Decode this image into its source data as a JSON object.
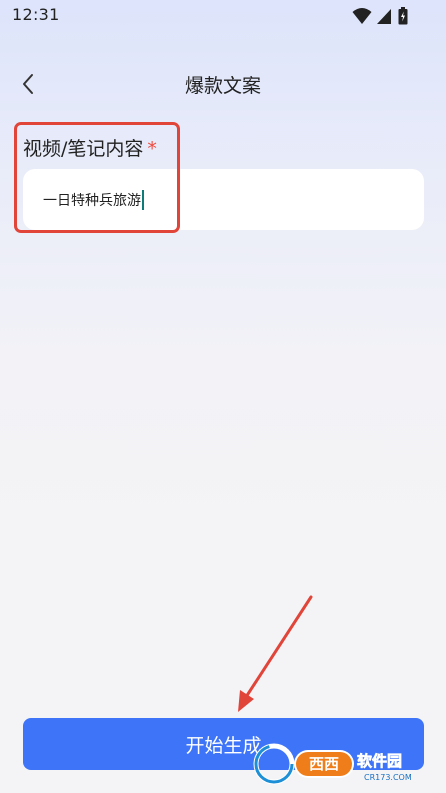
{
  "status_bar": {
    "time": "12:31",
    "icons": [
      "wifi-icon",
      "signal-icon",
      "battery-icon"
    ]
  },
  "header": {
    "back_icon": "chevron-left-icon",
    "title": "爆款文案"
  },
  "form": {
    "content_label": "视频/笔记内容",
    "required_mark": "*",
    "content_value": "一日特种兵旅游"
  },
  "actions": {
    "start_label": "开始生成"
  },
  "watermark": {
    "text": "西西软件园",
    "subtext": "CR173.COM"
  },
  "colors": {
    "accent": "#3d74f8",
    "highlight": "#e1453a",
    "required": "#ef4a3f"
  }
}
